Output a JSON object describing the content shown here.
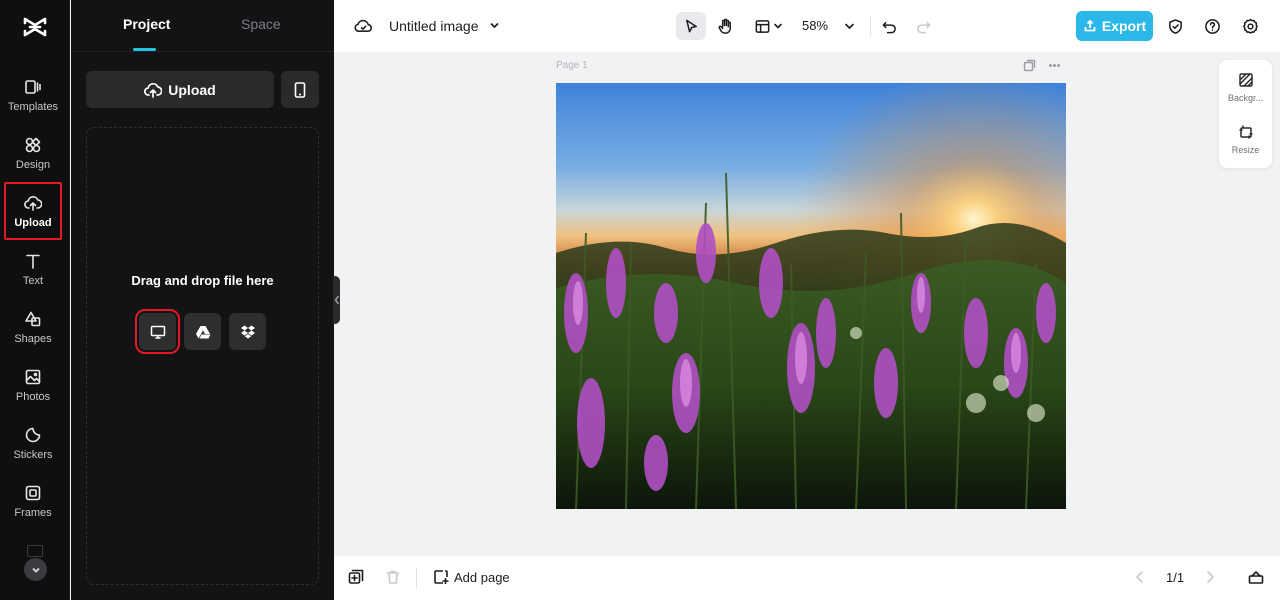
{
  "rail": {
    "items": [
      {
        "label": "Templates",
        "icon": "templates-icon"
      },
      {
        "label": "Design",
        "icon": "design-icon"
      },
      {
        "label": "Upload",
        "icon": "upload-cloud-icon"
      },
      {
        "label": "Text",
        "icon": "text-icon"
      },
      {
        "label": "Shapes",
        "icon": "shapes-icon"
      },
      {
        "label": "Photos",
        "icon": "photos-icon"
      },
      {
        "label": "Stickers",
        "icon": "stickers-icon"
      },
      {
        "label": "Frames",
        "icon": "frames-icon"
      }
    ],
    "active": "Upload"
  },
  "panel": {
    "tabs": [
      {
        "label": "Project"
      },
      {
        "label": "Space"
      }
    ],
    "upload_label": "Upload",
    "drop_text": "Drag and drop file here",
    "sources": [
      "computer-icon",
      "google-drive-icon",
      "dropbox-icon"
    ]
  },
  "topbar": {
    "title": "Untitled image",
    "zoom": "58%",
    "export_label": "Export",
    "accent": "#2bb8e8"
  },
  "canvas": {
    "page_label": "Page 1"
  },
  "side_panel": {
    "items": [
      {
        "label": "Backgr..."
      },
      {
        "label": "Resize"
      }
    ]
  },
  "bottombar": {
    "add_page_label": "Add page",
    "pager": "1/1"
  }
}
